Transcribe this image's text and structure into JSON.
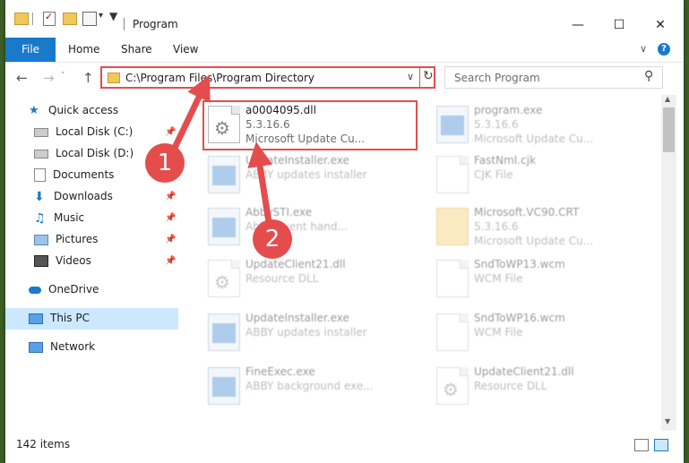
{
  "window": {
    "title": "Program",
    "controls": {
      "minimize": "—",
      "maximize": "☐",
      "close": "✕"
    }
  },
  "ribbon": {
    "file": "File",
    "home": "Home",
    "share": "Share",
    "view": "View",
    "help": "?"
  },
  "nav": {
    "back": "←",
    "forward": "→",
    "recent": "˅",
    "up": "↑",
    "address": "C:\\Program Files\\Program Directory",
    "refresh": "↻",
    "search_placeholder": "Search Program"
  },
  "sidebar": {
    "quick_access": "Quick access",
    "items": [
      {
        "label": "Local Disk (C:)",
        "icon": "drive-icon"
      },
      {
        "label": "Local Disk (D:)",
        "icon": "drive-icon"
      },
      {
        "label": "Documents",
        "icon": "documents-icon"
      },
      {
        "label": "Downloads",
        "icon": "downloads-icon"
      },
      {
        "label": "Music",
        "icon": "music-icon"
      },
      {
        "label": "Pictures",
        "icon": "pictures-icon"
      },
      {
        "label": "Videos",
        "icon": "videos-icon"
      }
    ],
    "onedrive": "OneDrive",
    "thispc": "This PC",
    "network": "Network"
  },
  "files": [
    {
      "name": "a0004095.dll",
      "line2": "5.3.16.6",
      "line3": "Microsoft Update Cu..."
    },
    {
      "name": "program.exe",
      "line2": "5.3.16.6",
      "line3": "Microsoft Update Cu..."
    },
    {
      "name": "UpdateInstaller.exe",
      "line2": "ABBY updates installer",
      "line3": ""
    },
    {
      "name": "FastNmI.cjk",
      "line2": "CJK File",
      "line3": ""
    },
    {
      "name": "AbbySTI.exe",
      "line2": "Abby event hand...",
      "line3": ""
    },
    {
      "name": "Microsoft.VC90.CRT",
      "line2": "5.3.16.6",
      "line3": "Microsoft Update Cu..."
    },
    {
      "name": "UpdateClient21.dll",
      "line2": "Resource DLL",
      "line3": ""
    },
    {
      "name": "SndToWP13.wcm",
      "line2": "WCM File",
      "line3": ""
    },
    {
      "name": "UpdateInstaller.exe",
      "line2": "ABBY updates installer",
      "line3": ""
    },
    {
      "name": "SndToWP16.wcm",
      "line2": "WCM File",
      "line3": ""
    },
    {
      "name": "FineExec.exe",
      "line2": "ABBY background exe...",
      "line3": ""
    },
    {
      "name": "UpdateClient21.dll",
      "line2": "Resource DLL",
      "line3": ""
    }
  ],
  "status": {
    "count": "142 items"
  },
  "annotations": {
    "step1": "1",
    "step2": "2"
  },
  "colors": {
    "accent": "#1979ca",
    "highlight": "#e54d4d",
    "selection": "#cce8ff"
  }
}
